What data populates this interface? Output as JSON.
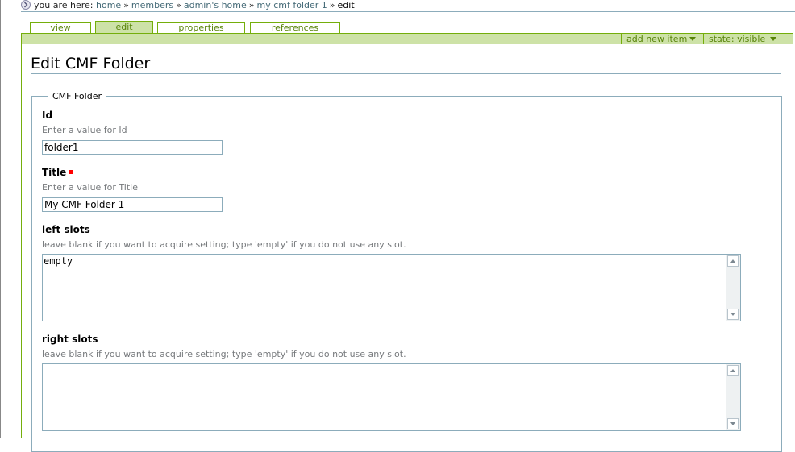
{
  "breadcrumb": {
    "prefix": "you are here:",
    "items": [
      "home",
      "members",
      "admin's home",
      "my cmf folder 1"
    ],
    "separator": "»",
    "current": "edit"
  },
  "tabs": [
    {
      "label": "view",
      "active": false
    },
    {
      "label": "edit",
      "active": true
    },
    {
      "label": "properties",
      "active": false
    },
    {
      "label": "references",
      "active": false
    }
  ],
  "actions": {
    "add_new_item": "add new item",
    "state": "state: visible"
  },
  "page": {
    "title": "Edit CMF Folder"
  },
  "form": {
    "legend": "CMF Folder",
    "id": {
      "label": "Id",
      "help": "Enter a value for Id",
      "value": "folder1"
    },
    "title": {
      "label": "Title",
      "help": "Enter a value for Title",
      "value": "My CMF Folder 1",
      "required": true
    },
    "left_slots": {
      "label": "left slots",
      "help": "leave blank if you want to acquire setting; type 'empty' if you do not use any slot.",
      "value": "empty"
    },
    "right_slots": {
      "label": "right slots",
      "help": "leave blank if you want to acquire setting; type 'empty' if you do not use any slot.",
      "value": ""
    }
  },
  "colors": {
    "accent_green": "#74ae0b",
    "tab_active_bg": "#cde2a7",
    "link": "#436976",
    "required": "#ff0000"
  }
}
